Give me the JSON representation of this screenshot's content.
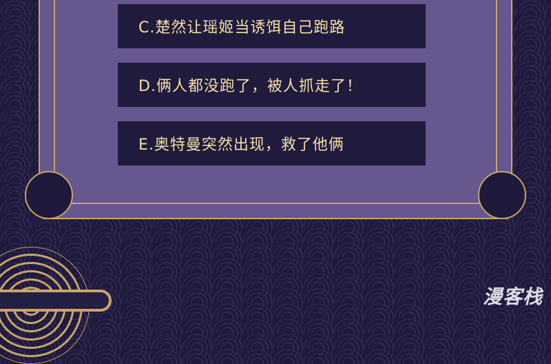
{
  "options": [
    {
      "id": "C",
      "text": "C.楚然让瑶姬当诱饵自己跑路"
    },
    {
      "id": "D",
      "text": "D.俩人都没跑了，被人抓走了！"
    },
    {
      "id": "E",
      "text": "E.奥特曼突然出现，救了他俩"
    }
  ],
  "watermark": "漫客栈"
}
